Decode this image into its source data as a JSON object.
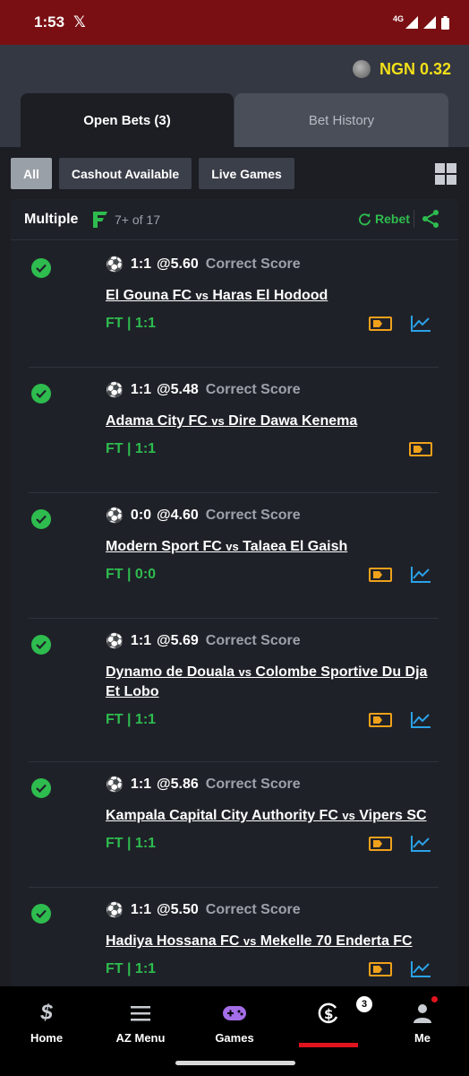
{
  "status_bar": {
    "time": "1:53",
    "network": "4G"
  },
  "header": {
    "balance": "NGN 0.32"
  },
  "tabs": [
    {
      "label": "Open Bets (3)"
    },
    {
      "label": "Bet History"
    }
  ],
  "filters": [
    {
      "label": "All"
    },
    {
      "label": "Cashout Available"
    },
    {
      "label": "Live Games"
    }
  ],
  "betslip": {
    "type": "Multiple",
    "count_label": "7+ of 17",
    "rebet_label": "Rebet",
    "selections": [
      {
        "score": "1:1",
        "odds": "@5.60",
        "market": "Correct Score",
        "home": "El Gouna FC",
        "vs": "vs",
        "away": "Haras El Hodood",
        "result": "FT | 1:1",
        "has_stats": true
      },
      {
        "score": "1:1",
        "odds": "@5.48",
        "market": "Correct Score",
        "home": "Adama City FC",
        "vs": "vs",
        "away": "Dire Dawa Kenema",
        "result": "FT | 1:1",
        "has_stats": false
      },
      {
        "score": "0:0",
        "odds": "@4.60",
        "market": "Correct Score",
        "home": "Modern Sport FC",
        "vs": "vs",
        "away": "Talaea El Gaish",
        "result": "FT | 0:0",
        "has_stats": true
      },
      {
        "score": "1:1",
        "odds": "@5.69",
        "market": "Correct Score",
        "home": "Dynamo de Douala",
        "vs": "vs",
        "away": "Colombe Sportive Du Dja Et Lobo",
        "result": "FT | 1:1",
        "has_stats": true
      },
      {
        "score": "1:1",
        "odds": "@5.86",
        "market": "Correct Score",
        "home": "Kampala Capital City Authority FC",
        "vs": "vs",
        "away": "Vipers SC",
        "result": "FT | 1:1",
        "has_stats": true
      },
      {
        "score": "1:1",
        "odds": "@5.50",
        "market": "Correct Score",
        "home": "Hadiya Hossana FC",
        "vs": "vs",
        "away": "Mekelle 70 Enderta FC",
        "result": "FT | 1:1",
        "has_stats": true
      }
    ]
  },
  "bottom_nav": [
    {
      "label": "Home",
      "icon": "sporty-logo-icon"
    },
    {
      "label": "AZ Menu",
      "icon": "hamburger-icon"
    },
    {
      "label": "Games",
      "icon": "gamepad-icon"
    },
    {
      "label": "",
      "icon": "open-bets-icon",
      "badge": "3"
    },
    {
      "label": "Me",
      "icon": "person-icon"
    }
  ],
  "colors": {
    "accent_green": "#2ebc4f",
    "balance_yellow": "#f3e019",
    "status_bar": "#7a0f13",
    "tv_orange": "#f0a11b",
    "stats_blue": "#2aa2e8"
  }
}
